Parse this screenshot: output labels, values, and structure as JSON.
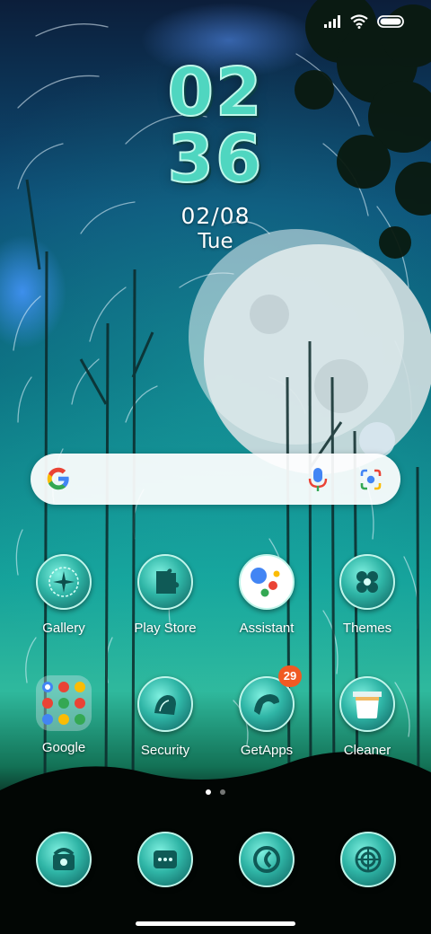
{
  "status_bar": {
    "signal_icon": "signal-bars-icon",
    "wifi_icon": "wifi-icon",
    "battery_icon": "battery-icon"
  },
  "clock": {
    "hour": "02",
    "minute": "36",
    "date": "02/08",
    "weekday": "Tue"
  },
  "search_bar": {
    "logo": "google-g-icon",
    "mic_icon": "mic-icon",
    "lens_icon": "lens-camera-icon"
  },
  "apps_row1": [
    {
      "label": "Gallery",
      "icon": "gallery-icon"
    },
    {
      "label": "Play Store",
      "icon": "play-store-icon"
    },
    {
      "label": "Assistant",
      "icon": "assistant-icon"
    },
    {
      "label": "Themes",
      "icon": "themes-icon"
    }
  ],
  "apps_row2": [
    {
      "label": "Google",
      "icon": "google-folder-icon"
    },
    {
      "label": "Security",
      "icon": "security-icon"
    },
    {
      "label": "GetApps",
      "icon": "getapps-icon",
      "badge": "29"
    },
    {
      "label": "Cleaner",
      "icon": "cleaner-icon"
    }
  ],
  "page_indicator": {
    "pages": 2,
    "current": 1
  },
  "dock": [
    {
      "icon": "phone-icon"
    },
    {
      "icon": "messages-icon"
    },
    {
      "icon": "browser-icon"
    },
    {
      "icon": "camera-icon"
    }
  ],
  "colors": {
    "accent": "#4fd6c0",
    "badge": "#f05a23"
  }
}
